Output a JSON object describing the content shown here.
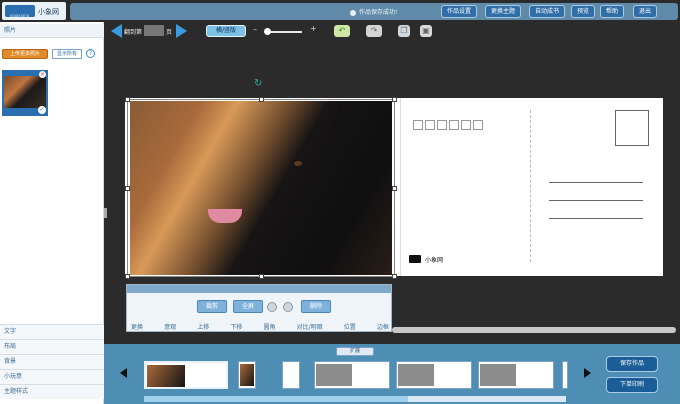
{
  "brand": {
    "name": "小象网",
    "sub": "xiaoxiang"
  },
  "topbar": {
    "message": "作品保存成功!",
    "buttons": [
      "作品设置",
      "更换主题",
      "自动成书",
      "预览",
      "帮助",
      "退出"
    ]
  },
  "left_panel": {
    "tab_label": "照片",
    "upload_label": "上传更多照片",
    "show_all_label": "显示所有",
    "help_glyph": "?",
    "nav_items": [
      "文字",
      "布局",
      "背景",
      "小玩意",
      "主题样式"
    ]
  },
  "toolbar": {
    "page_prefix": "翻到第",
    "page_value": "",
    "page_unit": "页",
    "orientation_label": "横/竖版"
  },
  "postcard": {
    "brand_label": "小象网"
  },
  "edit_panel": {
    "buttons": [
      "裁剪",
      "全屏",
      "删除"
    ],
    "tabs": [
      "更换",
      "意观",
      "上移",
      "下移",
      "圆角",
      "对比/明暗",
      "位置",
      "边框"
    ]
  },
  "bottom": {
    "expand_label": "扩展",
    "save_label": "保存作品",
    "order_label": "下单印刷"
  },
  "colors": {
    "accent": "#2f6ea6",
    "bottom_bg": "#4f8eb4",
    "orange": "#e08a2a"
  }
}
